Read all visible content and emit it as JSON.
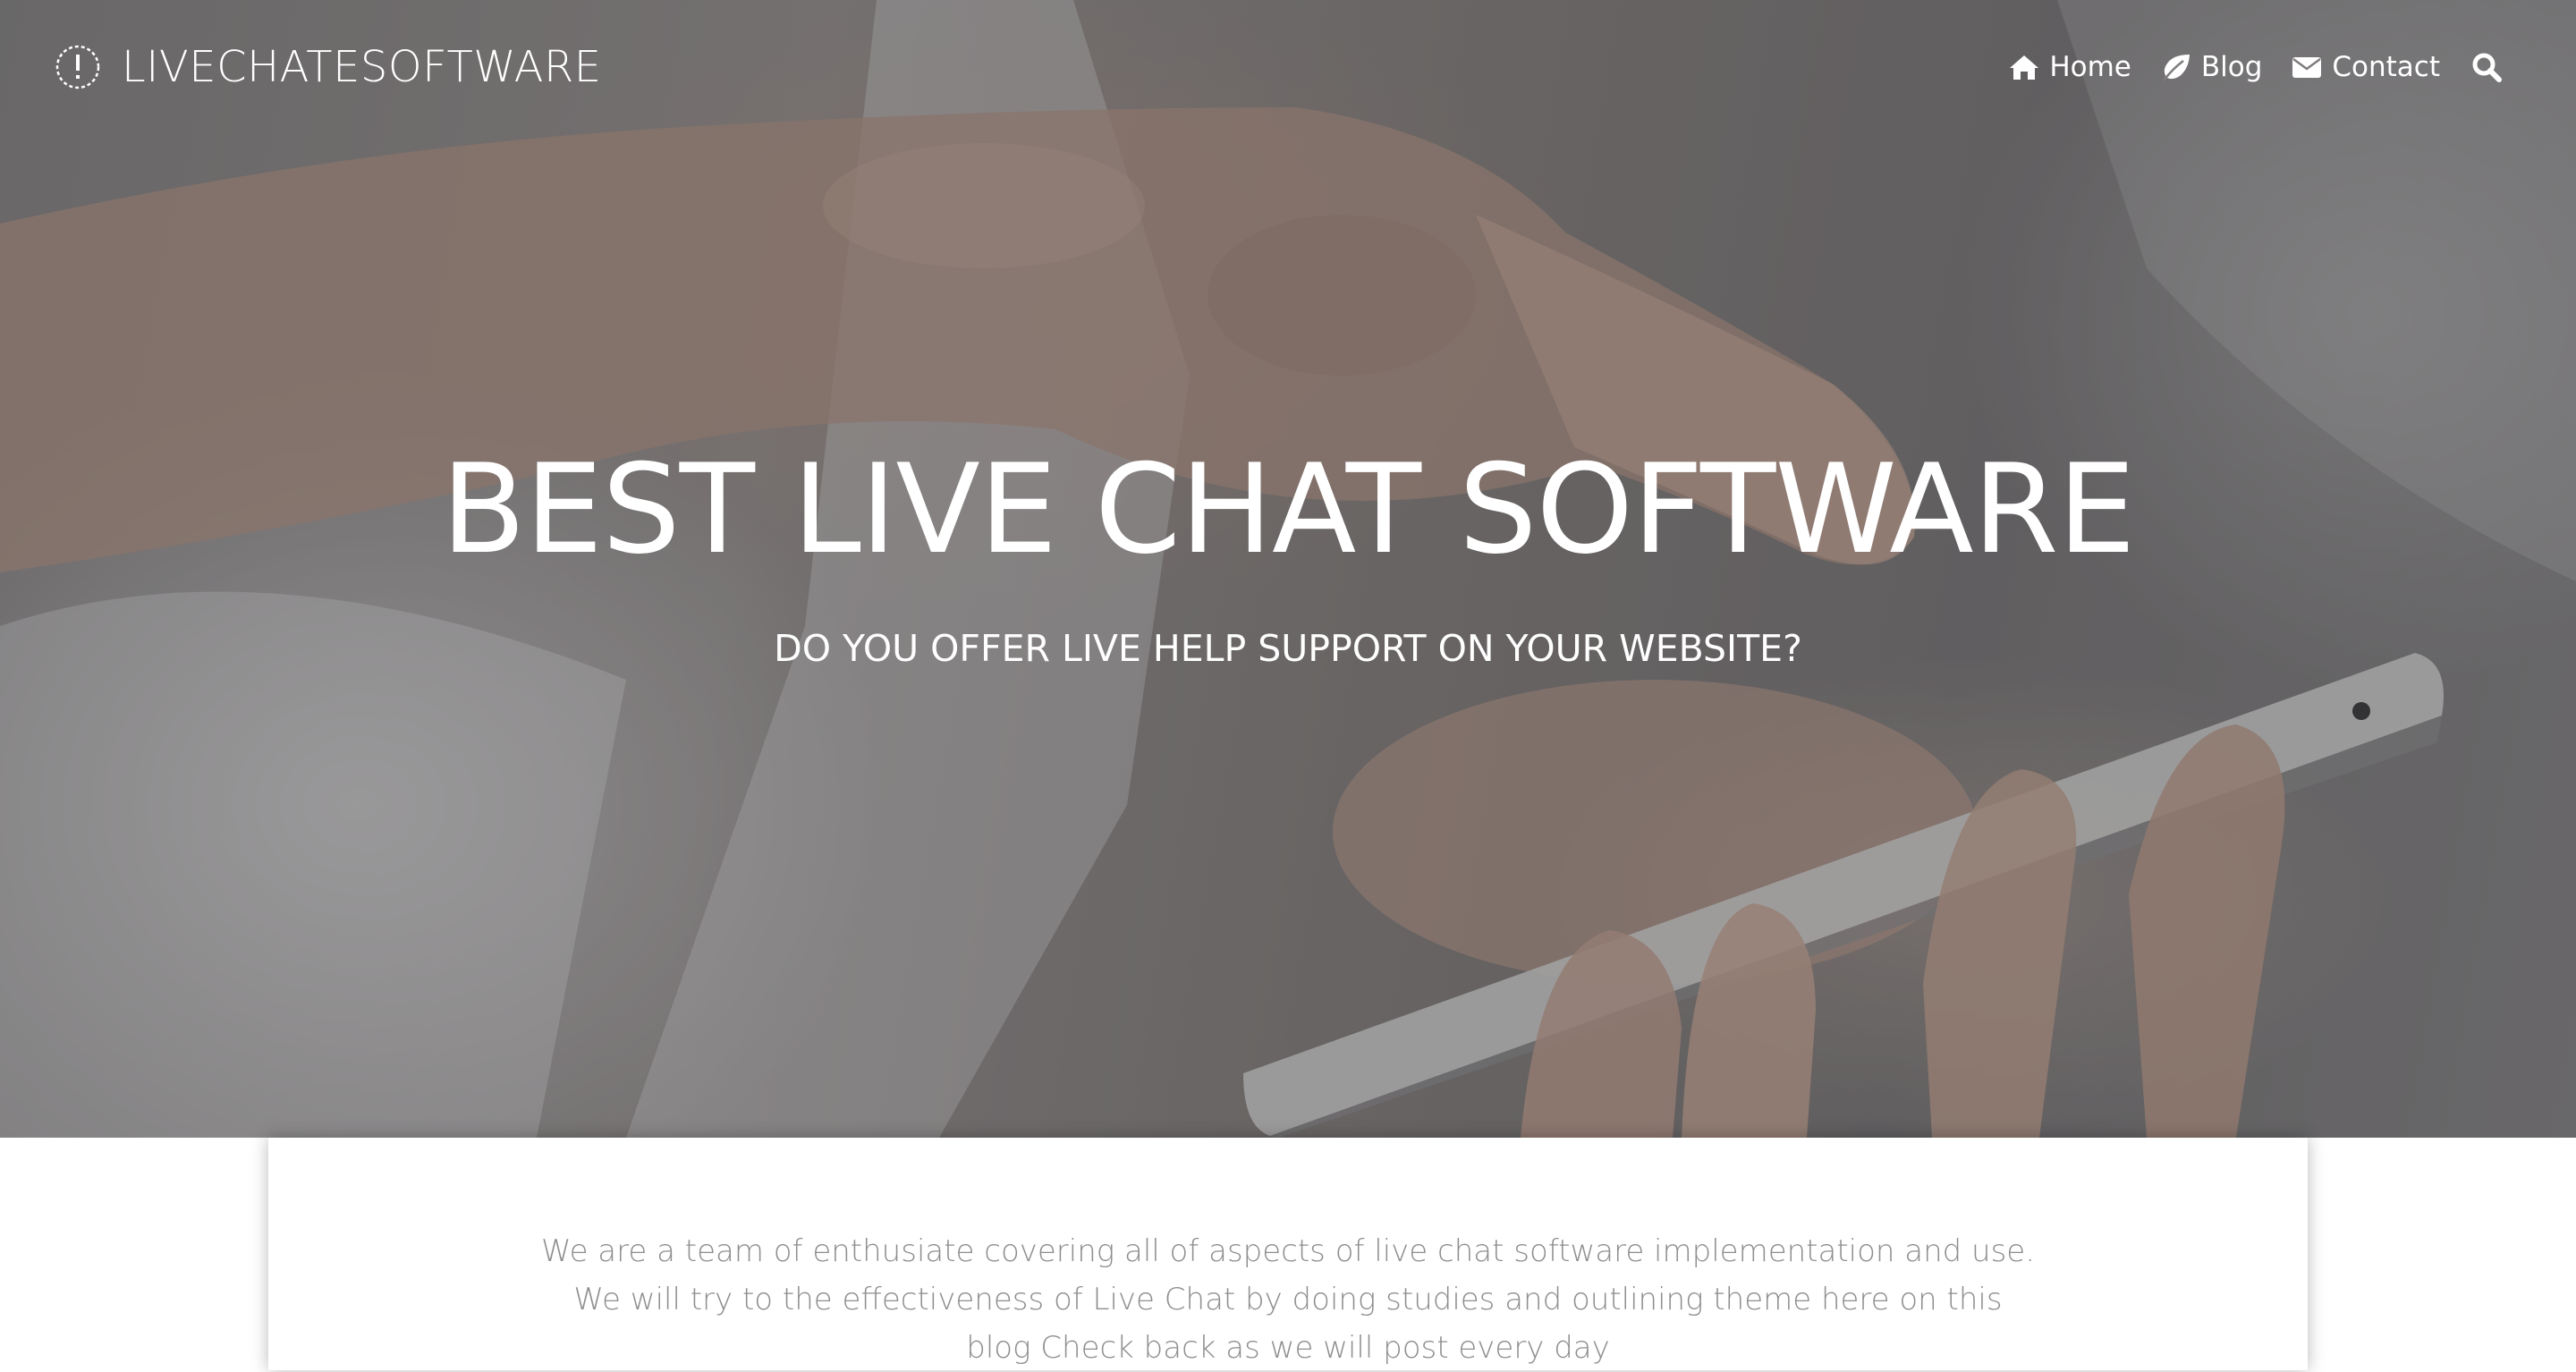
{
  "brand": {
    "name": "LIVECHATESOFTWARE",
    "icon": "info-circle-icon"
  },
  "nav": {
    "items": [
      {
        "label": "Home",
        "icon": "home-icon"
      },
      {
        "label": "Blog",
        "icon": "leaf-icon"
      },
      {
        "label": "Contact",
        "icon": "envelope-icon"
      }
    ],
    "search_icon": "search-icon"
  },
  "hero": {
    "title": "BEST LIVE CHAT SOFTWARE",
    "subtitle": "DO YOU OFFER LIVE HELP SUPPORT ON YOUR WEBSITE?"
  },
  "intro": {
    "lines": [
      "We are a team of enthusiate covering all of aspects of live chat software implementation and use.",
      "We will try to the effectiveness of Live Chat by doing studies and outlining theme here on this",
      "blog Check back as we will post every day"
    ]
  },
  "colors": {
    "text_on_hero": "#ffffff",
    "body_text": "#8e8e8e",
    "card_bg": "#ffffff"
  }
}
